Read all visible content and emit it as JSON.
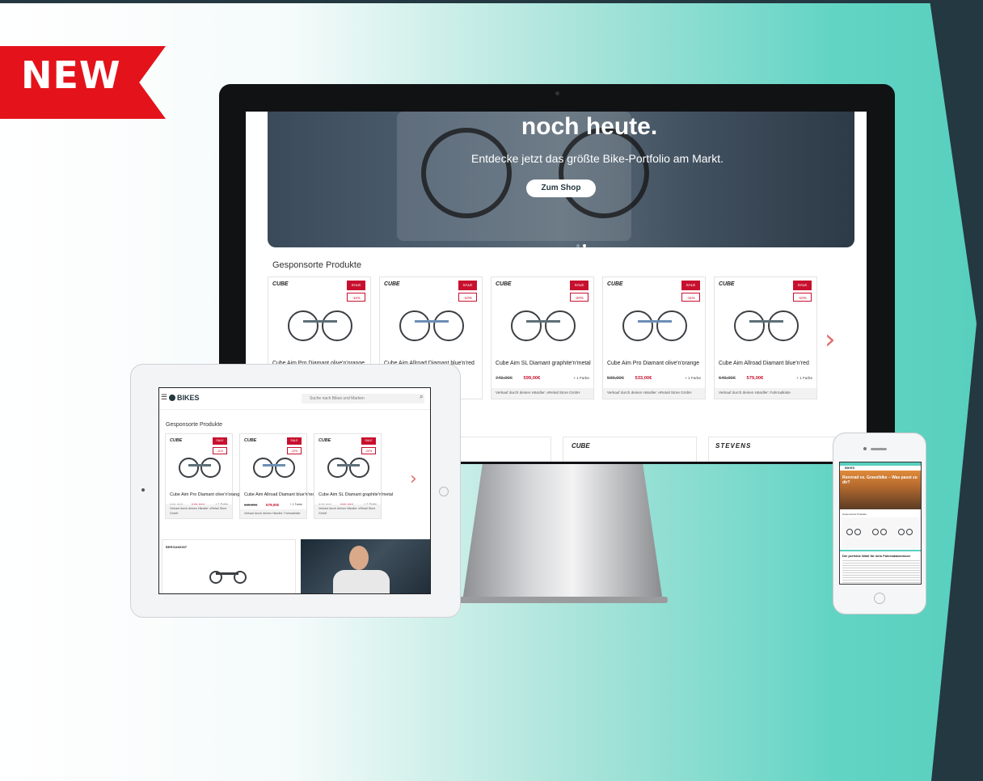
{
  "badge": {
    "label": "NEW"
  },
  "colors": {
    "accent": "#58cfbe",
    "dark": "#243841",
    "ribbon": "#e4131b",
    "sale": "#c8102e"
  },
  "desktop": {
    "hero": {
      "title": "noch heute.",
      "subtitle": "Entdecke jetzt das größte Bike-Portfolio am Markt.",
      "cta_label": "Zum Shop"
    },
    "section_title": "Gesponsorte Produkte",
    "products": [
      {
        "brand": "CUBE",
        "sale": "SALE",
        "discount": "-11%",
        "name": "Cube Aim Pro Diamant olive'n'orange",
        "old_price": "",
        "new_price": "",
        "colors": "",
        "seller": ""
      },
      {
        "brand": "CUBE",
        "sale": "SALE",
        "discount": "-10%",
        "name": "Cube Aim Allroad Diamant blue'n'red",
        "old_price": "",
        "new_price": "",
        "colors": "",
        "seller": ""
      },
      {
        "brand": "CUBE",
        "sale": "SALE",
        "discount": "-20%",
        "name": "Cube Aim SL Diamant graphite'n'metal",
        "old_price": "749,00€",
        "new_price": "599,00€",
        "colors": "+ 1 Farbe",
        "seller": "Verkauf durch deinen Händler: eRetail Store GmbH"
      },
      {
        "brand": "CUBE",
        "sale": "SALE",
        "discount": "-11%",
        "name": "Cube Aim Pro Diamant olive'n'orange",
        "old_price": "599,00€",
        "new_price": "533,00€",
        "colors": "+ 1 Farbe",
        "seller": "Verkauf durch deinen Händler: eRetail Store GmbH"
      },
      {
        "brand": "CUBE",
        "sale": "SALE",
        "discount": "-10%",
        "name": "Cube Aim Allroad Diamant blue'n'red",
        "old_price": "649,00€",
        "new_price": "579,00€",
        "colors": "+ 1 Farbe",
        "seller": "Verkauf durch deinen Händler: Fahrradkiste"
      }
    ],
    "brands": [
      "CUBE",
      "STEVENS"
    ]
  },
  "tablet": {
    "logo": "BIKES",
    "search_placeholder": "Suche nach Bikes und Marken",
    "section_title": "Gesponsorte Produkte",
    "products": [
      {
        "brand": "CUBE",
        "sale": "SALE",
        "discount": "-11%",
        "name": "Cube Aim Pro Diamant olive'n'orange",
        "old_price": "599,00€",
        "new_price": "533,00€",
        "colors": "+ 1 Farbe",
        "seller": "Verkauf durch deinen Händler: eRetail Store GmbH"
      },
      {
        "brand": "CUBE",
        "sale": "SALE",
        "discount": "-10%",
        "name": "Cube Aim Allroad Diamant blue'n'red",
        "old_price": "649,00€",
        "new_price": "579,00€",
        "colors": "+ 1 Farbe",
        "seller": "Verkauf durch deinen Händler: Fahrradkiste"
      },
      {
        "brand": "CUBE",
        "sale": "SALE",
        "discount": "-20%",
        "name": "Cube Aim SL Diamant graphite'n'metal",
        "old_price": "749,00€",
        "new_price": "599,00€",
        "colors": "+ 1 Farbe",
        "seller": "Verkauf durch deinen Händler: eRetail Store GmbH"
      }
    ],
    "banner_brand": "BERGAMONT"
  },
  "phone": {
    "logo": "BIKES",
    "hero_title": "Rennrad vs. Gravelbike – Was passt zu dir?",
    "section_title": "Gesponsorte Produkte",
    "article_title": "Die perfekte Wahl für dein Fahrradabenteuer"
  }
}
